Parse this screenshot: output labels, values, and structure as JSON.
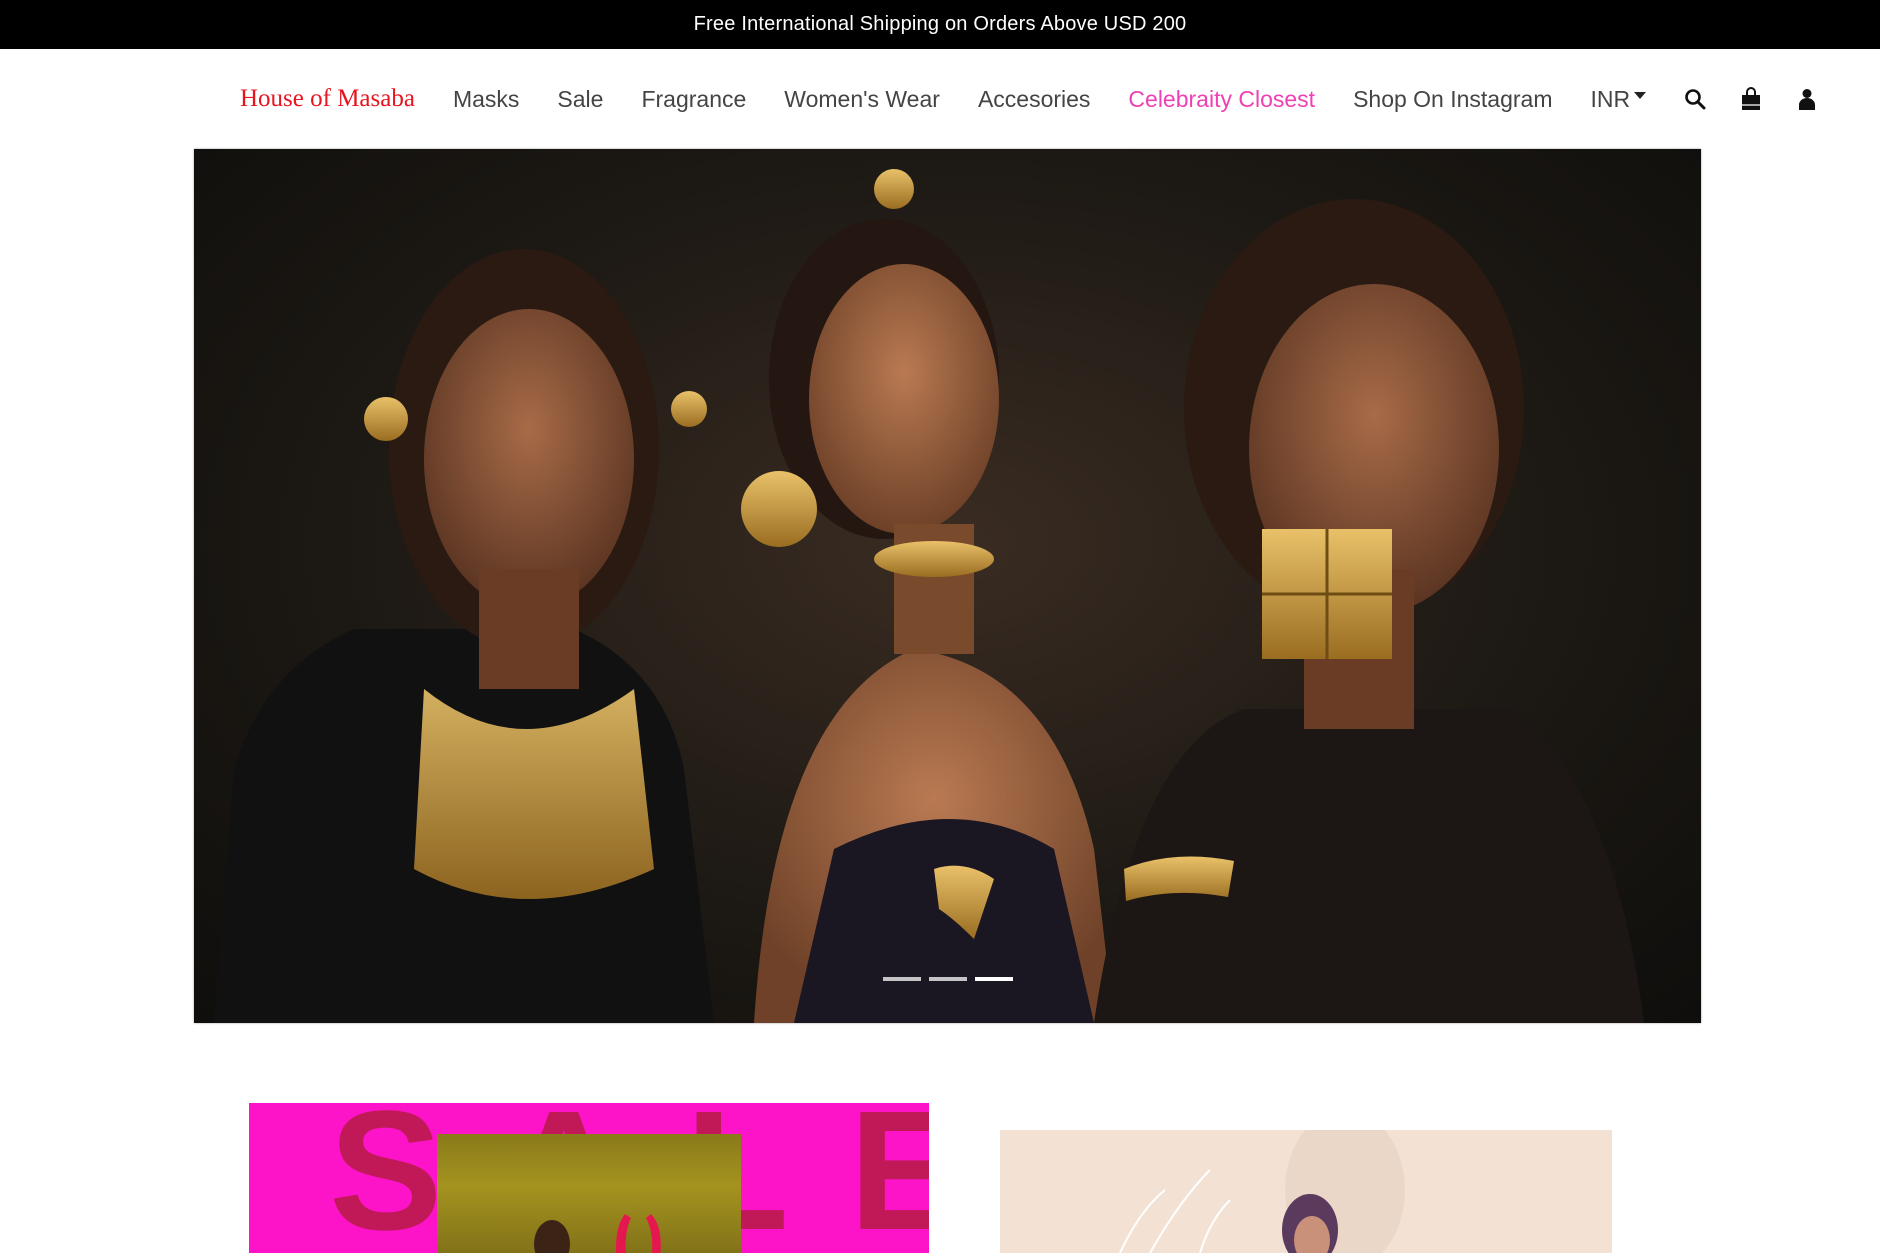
{
  "announcement": {
    "text": "Free International Shipping on Orders Above USD 200"
  },
  "header": {
    "brand": "House of Masaba",
    "nav_items": [
      {
        "label": "Masks"
      },
      {
        "label": "Sale"
      },
      {
        "label": "Fragrance"
      },
      {
        "label": "Women's Wear"
      },
      {
        "label": "Accesories"
      },
      {
        "label": "Celebraity Closest"
      },
      {
        "label": "Shop On Instagram"
      }
    ],
    "currency": "INR",
    "icons": [
      "search-icon",
      "shopping-bag-icon",
      "user-icon"
    ]
  },
  "hero": {
    "slides_count": 3,
    "active_slide": 3
  },
  "promos": {
    "left": {
      "bg": "#fe14c8",
      "text": "SALE"
    },
    "right": {
      "bg": "#f3e2d4"
    }
  },
  "colors": {
    "brand": "#e8141f",
    "highlight": "#ef40b4",
    "topbar": "#000000"
  }
}
